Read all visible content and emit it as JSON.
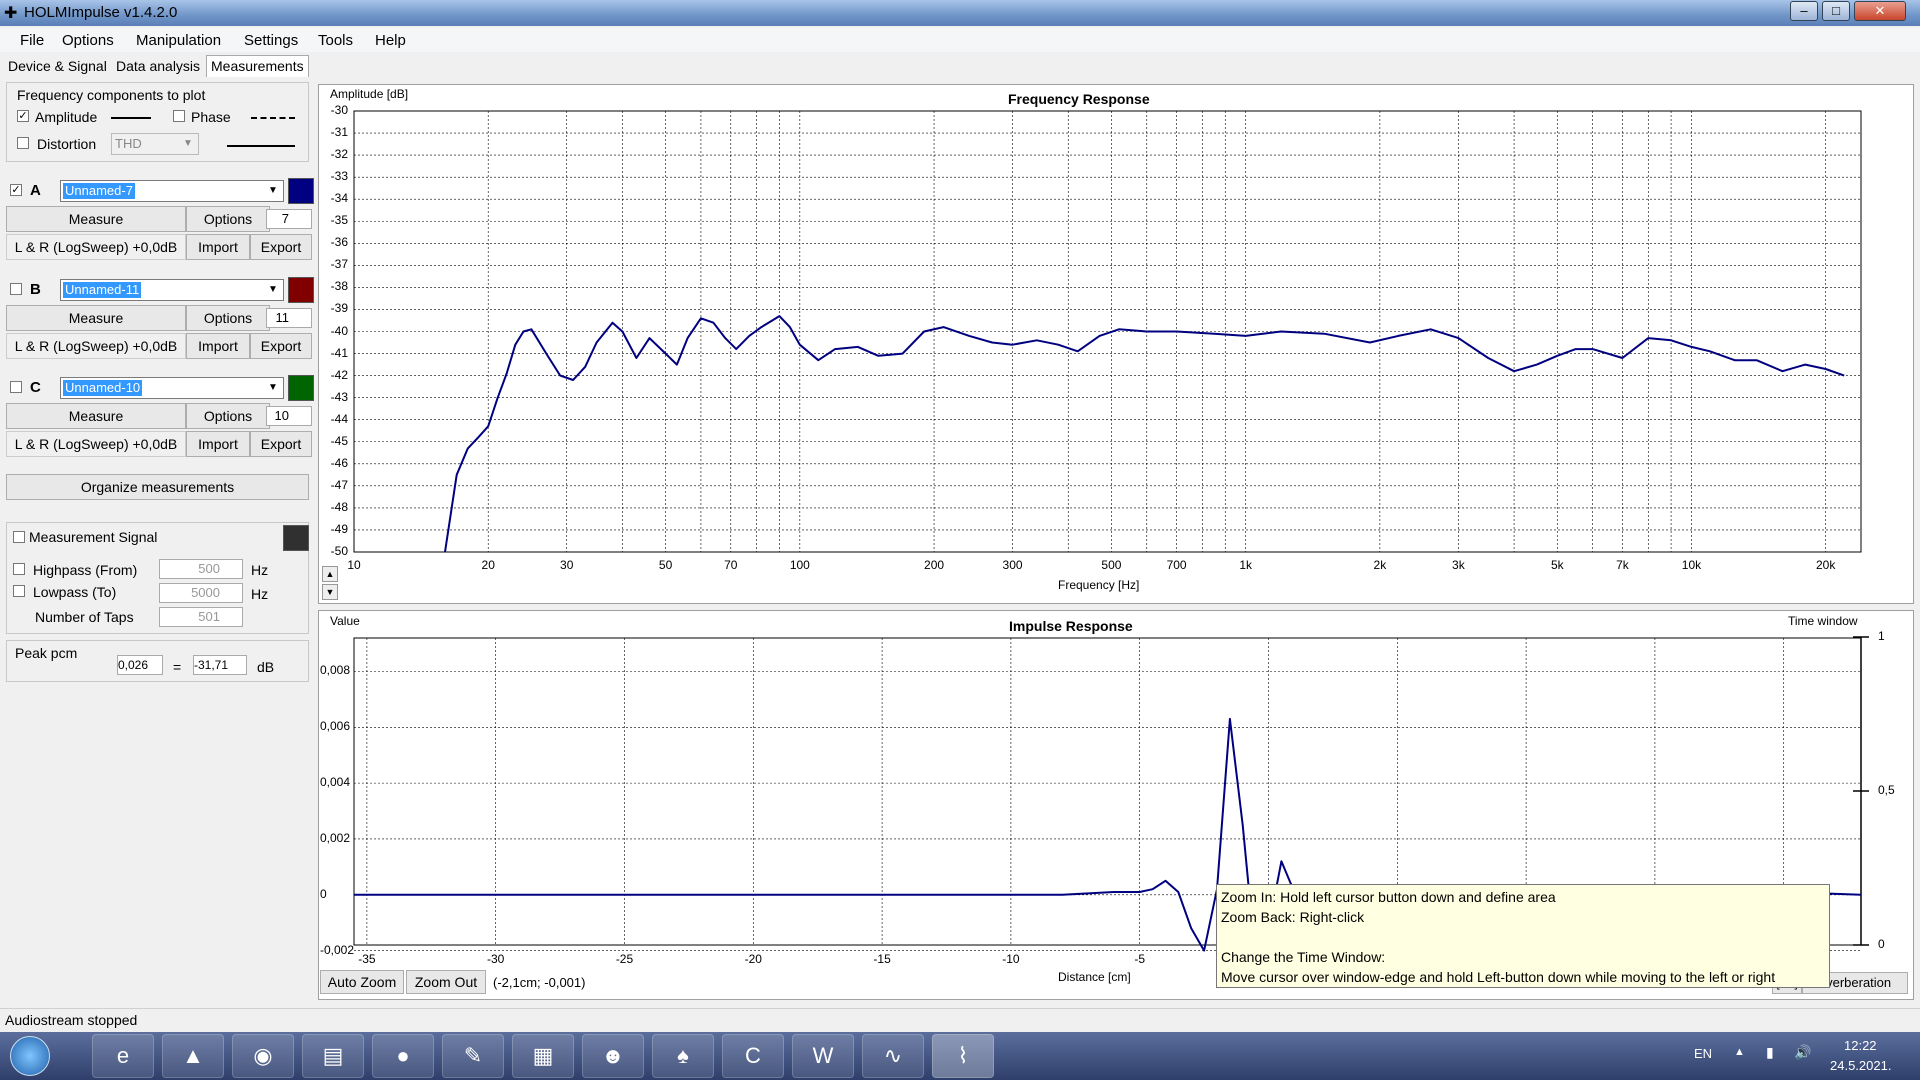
{
  "window": {
    "title": "HOLMImpulse  v1.4.2.0",
    "minimize": "–",
    "maximize": "□",
    "close": "✕"
  },
  "menu": [
    "File",
    "Options",
    "Manipulation",
    "Settings",
    "Tools",
    "Help"
  ],
  "tabs": [
    "Device & Signal",
    "Data analysis",
    "Measurements"
  ],
  "freq_components": {
    "title": "Frequency components to plot",
    "amplitude": "Amplitude",
    "phase": "Phase",
    "distortion": "Distortion",
    "thd": "THD"
  },
  "measurements": [
    {
      "letter": "A",
      "name": "Unnamed-7",
      "color": "#000080",
      "checked": "✓",
      "measure": "Measure",
      "options": "Options",
      "count": "7",
      "desc": "L & R (LogSweep) +0,0dB",
      "import": "Import",
      "export": "Export"
    },
    {
      "letter": "B",
      "name": "Unnamed-11",
      "color": "#800000",
      "checked": "",
      "measure": "Measure",
      "options": "Options",
      "count": "11",
      "desc": "L & R (LogSweep) +0,0dB",
      "import": "Import",
      "export": "Export"
    },
    {
      "letter": "C",
      "name": "Unnamed-10",
      "color": "#006400",
      "checked": "",
      "measure": "Measure",
      "options": "Options",
      "count": "10",
      "desc": "L & R (LogSweep) +0,0dB",
      "import": "Import",
      "export": "Export"
    }
  ],
  "organize": "Organize measurements",
  "signal": {
    "measurement_signal": "Measurement Signal",
    "signal_color": "#303030",
    "highpass": "Highpass (From)",
    "highpass_val": "500",
    "lowpass": "Lowpass (To)",
    "lowpass_val": "5000",
    "taps": "Number of Taps",
    "taps_val": "501",
    "hz": "Hz"
  },
  "peak": {
    "label": "Peak pcm",
    "pcm": "0,026",
    "eq": "=",
    "db_val": "-31,71",
    "db": "dB"
  },
  "fr_plot": {
    "title": "Frequency Response",
    "ylabel": "Amplitude [dB]",
    "xlabel": "Frequency [Hz]",
    "yticks": [
      "-30",
      "-31",
      "-32",
      "-33",
      "-34",
      "-35",
      "-36",
      "-37",
      "-38",
      "-39",
      "-40",
      "-41",
      "-42",
      "-43",
      "-44",
      "-45",
      "-46",
      "-47",
      "-48",
      "-49",
      "-50"
    ],
    "xticks": [
      "10",
      "20",
      "30",
      "50",
      "70",
      "100",
      "200",
      "300",
      "500",
      "700",
      "1k",
      "2k",
      "3k",
      "5k",
      "7k",
      "10k",
      "20k"
    ],
    "scroll_up": "▲",
    "scroll_down": "▼"
  },
  "ir_plot": {
    "title": "Impulse Response",
    "ylabel": "Value",
    "xlabel": "Distance [cm]",
    "rlabel": "Time window",
    "yticks": [
      "0,008",
      "0,006",
      "0,004",
      "0,002",
      "0",
      "-0,002"
    ],
    "rticks": [
      "1",
      "0,5",
      "0"
    ],
    "xticks": [
      "-35",
      "-30",
      "-25",
      "-20",
      "-15",
      "-10",
      "-5"
    ],
    "auto_zoom": "Auto Zoom",
    "zoom_out": "Zoom Out",
    "cursor": "(-2,1cm; -0,001)",
    "db_btn": "[dB]",
    "reverb_btn": "everberation"
  },
  "tooltip": {
    "line1": "Zoom In:   Hold left cursor button down and define area",
    "line2": "Zoom Back: Right-click",
    "line3": "Change the Time Window:",
    "line4": "Move cursor over window-edge and hold Left-button down while moving to the left or right"
  },
  "status": "Audiostream stopped",
  "taskbar": {
    "lang": "EN",
    "time": "12:22",
    "date": "24.5.2021.",
    "tray_up": "▲",
    "signal": "▮",
    "volume": "🔊"
  },
  "chart_data": [
    {
      "type": "line",
      "title": "Frequency Response",
      "xlabel": "Frequency [Hz]",
      "ylabel": "Amplitude [dB]",
      "xscale": "log",
      "xlim": [
        10,
        24000
      ],
      "ylim": [
        -50,
        -30
      ],
      "grid": true,
      "series": [
        {
          "color": "#000080",
          "x": [
            16,
            17,
            18,
            19,
            20,
            21,
            22,
            23,
            24,
            25,
            27,
            29,
            31,
            33,
            35,
            38,
            40,
            43,
            46,
            50,
            53,
            56,
            60,
            64,
            68,
            72,
            77,
            82,
            90,
            95,
            100,
            110,
            120,
            135,
            150,
            170,
            190,
            210,
            240,
            270,
            300,
            340,
            380,
            420,
            470,
            520,
            600,
            700,
            850,
            1000,
            1200,
            1500,
            1900,
            2200,
            2600,
            3000,
            3500,
            4000,
            4500,
            5000,
            5500,
            6000,
            7000,
            8000,
            9000,
            10000,
            11000,
            12500,
            14000,
            16000,
            18000,
            20000,
            22000
          ],
          "y": [
            -50.0,
            -46.5,
            -45.3,
            -44.8,
            -44.3,
            -43.0,
            -41.9,
            -40.6,
            -40.0,
            -39.9,
            -41.0,
            -42.0,
            -42.2,
            -41.6,
            -40.5,
            -39.6,
            -40.0,
            -41.2,
            -40.3,
            -41.0,
            -41.5,
            -40.3,
            -39.4,
            -39.6,
            -40.3,
            -40.8,
            -40.2,
            -39.8,
            -39.3,
            -39.8,
            -40.6,
            -41.3,
            -40.8,
            -40.7,
            -41.1,
            -41.0,
            -40.0,
            -39.8,
            -40.2,
            -40.5,
            -40.6,
            -40.4,
            -40.6,
            -40.9,
            -40.2,
            -39.9,
            -40.0,
            -40.0,
            -40.1,
            -40.2,
            -40.0,
            -40.1,
            -40.5,
            -40.2,
            -39.9,
            -40.3,
            -41.2,
            -41.8,
            -41.5,
            -41.1,
            -40.8,
            -40.8,
            -41.2,
            -40.3,
            -40.4,
            -40.7,
            -40.9,
            -41.3,
            -41.3,
            -41.8,
            -41.5,
            -41.7,
            -42.0
          ]
        }
      ]
    },
    {
      "type": "line",
      "title": "Impulse Response",
      "xlabel": "Distance [cm]",
      "ylabel": "Value",
      "xlim": [
        -35.5,
        23
      ],
      "ylim": [
        -0.0018,
        0.0092
      ],
      "grid": true,
      "series": [
        {
          "color": "#000080",
          "x": [
            -35.5,
            -8,
            -6,
            -5,
            -4.5,
            -4,
            -3.5,
            -3,
            -2.5,
            -2,
            -1.5,
            -1,
            -0.5,
            0,
            0.5,
            1,
            1.5,
            2,
            2.5,
            3,
            3.5,
            4,
            4.5,
            5,
            5.5,
            6,
            7,
            8,
            9,
            10,
            12,
            14,
            16,
            18,
            20,
            23
          ],
          "y": [
            0,
            0,
            0.0001,
            0.0001,
            0.0002,
            0.0005,
            0.0001,
            -0.0012,
            -0.002,
            0.0002,
            0.0063,
            0.0025,
            -0.0023,
            -0.0012,
            0.0012,
            0.0001,
            -0.0009,
            -0.0005,
            -0.001,
            -0.0003,
            0.0001,
            -0.0004,
            -0.0005,
            -0.0001,
            0.0001,
            -0.0004,
            0.0001,
            -0.0002,
            0.0,
            0.0001,
            -0.0001,
            0.0001,
            0.0002,
            -0.0001,
            0.0001,
            0.0
          ]
        }
      ]
    }
  ]
}
